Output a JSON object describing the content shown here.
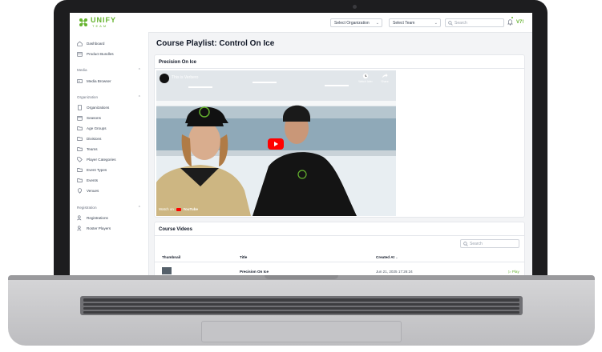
{
  "topbar": {
    "logo_text": "UNIFY",
    "logo_sub": "TEAM",
    "org_select": "Select Organization",
    "team_select": "Select Team",
    "search_placeholder": "Search",
    "avatar_text": "V7!",
    "brand_color": "#65b32e"
  },
  "sidebar": {
    "top_items": [
      {
        "label": "Dashboard",
        "icon": "home-icon"
      },
      {
        "label": "Product Bundles",
        "icon": "box-icon"
      }
    ],
    "sections": [
      {
        "title": "Media",
        "items": [
          {
            "label": "Media Browser",
            "icon": "media-icon"
          }
        ]
      },
      {
        "title": "Organization",
        "items": [
          {
            "label": "Organizations",
            "icon": "building-icon"
          },
          {
            "label": "Seasons",
            "icon": "calendar-icon"
          },
          {
            "label": "Age Groups",
            "icon": "folder-icon"
          },
          {
            "label": "Divisions",
            "icon": "folder-icon"
          },
          {
            "label": "Teams",
            "icon": "folder-icon"
          },
          {
            "label": "Player Categories",
            "icon": "tag-icon"
          },
          {
            "label": "Event Types",
            "icon": "folder-icon"
          },
          {
            "label": "Events",
            "icon": "folder-icon"
          },
          {
            "label": "Venues",
            "icon": "pin-icon"
          }
        ]
      },
      {
        "title": "Registration",
        "items": [
          {
            "label": "Registrations",
            "icon": "users-icon"
          },
          {
            "label": "Roster Players",
            "icon": "users-icon"
          }
        ]
      }
    ]
  },
  "main": {
    "page_title": "Course Playlist: Control On Ice",
    "video_card": {
      "title": "Precision On Ice",
      "video_title": "This is Verbero",
      "watch_later": "Watch later",
      "share": "Share",
      "watch_on": "Watch on",
      "youtube": "YouTube"
    },
    "videos_card": {
      "title": "Course Videos",
      "search_placeholder": "Search",
      "columns": [
        "Thumbnail",
        "Title",
        "Created At"
      ],
      "sort_indicator": "⌄",
      "rows": [
        {
          "title": "Precision On Ice",
          "created_at": "Jun 21, 2025 17:26:24",
          "action": "Play"
        }
      ]
    }
  }
}
